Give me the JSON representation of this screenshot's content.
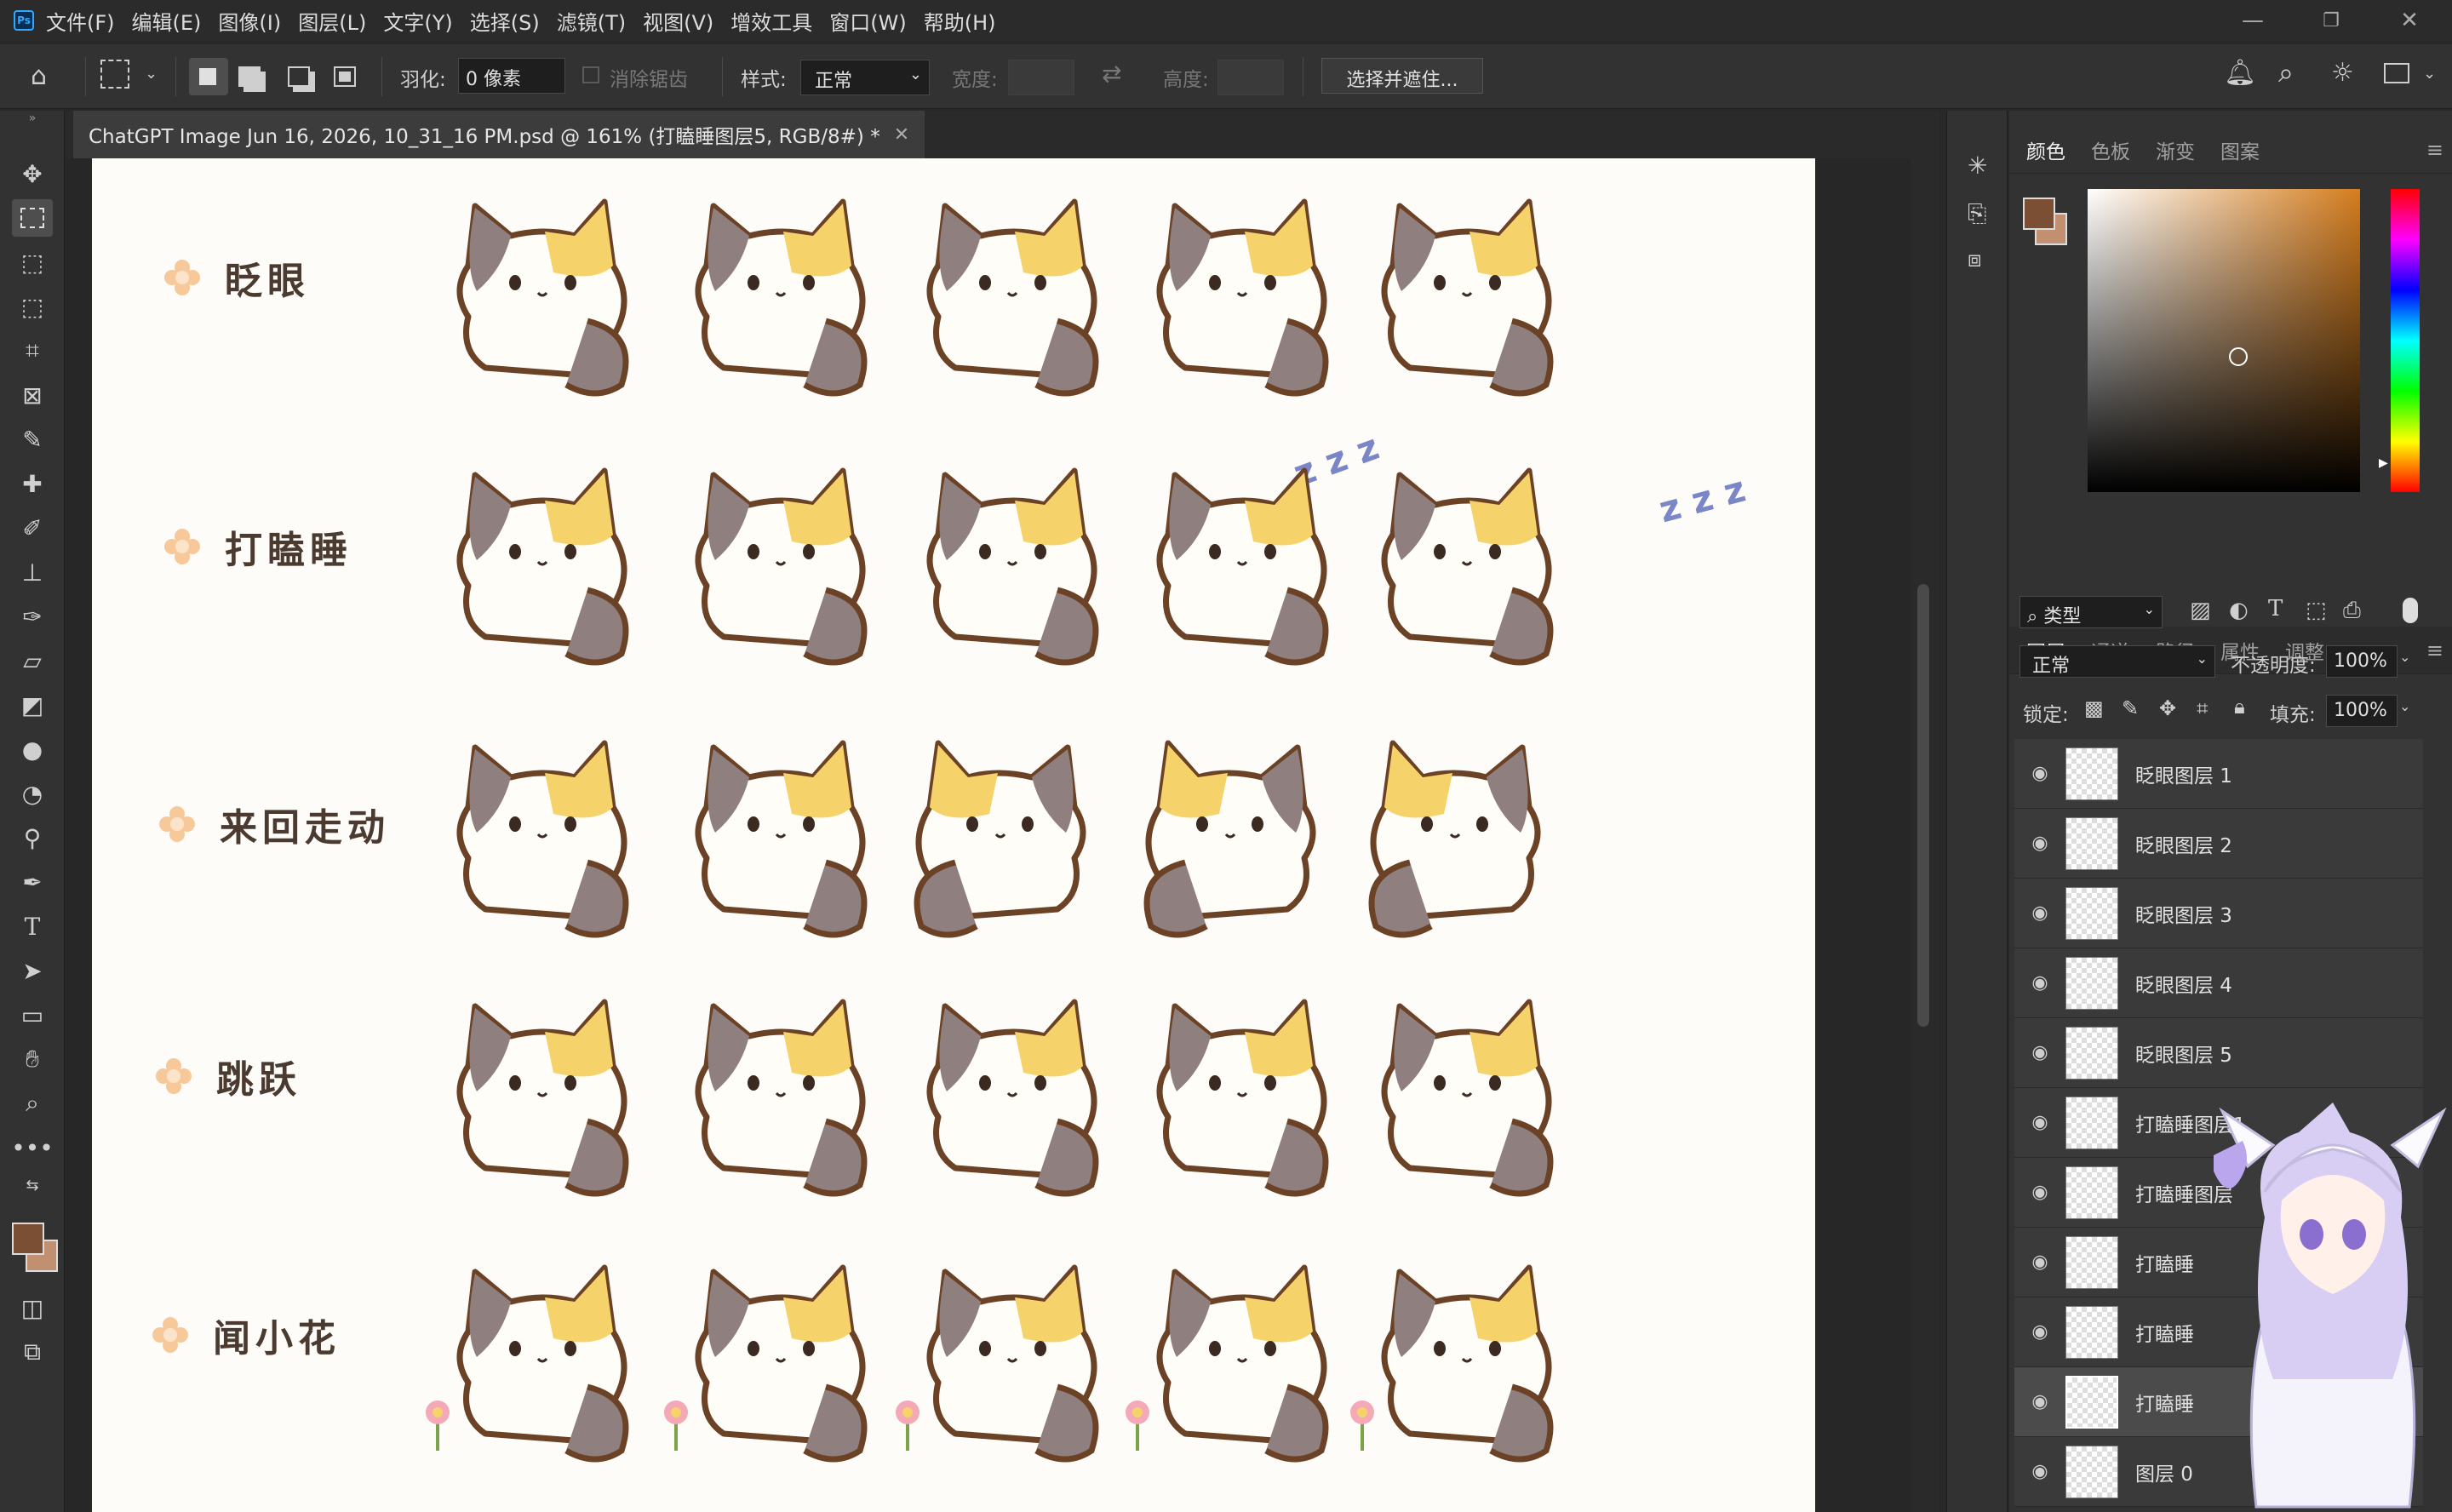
{
  "app": {
    "name": "Photoshop",
    "logo": "Ps"
  },
  "menu": [
    "文件(F)",
    "编辑(E)",
    "图像(I)",
    "图层(L)",
    "文字(Y)",
    "选择(S)",
    "滤镜(T)",
    "视图(V)",
    "增效工具",
    "窗口(W)",
    "帮助(H)"
  ],
  "window_controls": [
    "—",
    "❐",
    "✕"
  ],
  "options": {
    "feather_label": "羽化:",
    "feather_value": "0 像素",
    "antialias_label": "消除锯齿",
    "style_label": "样式:",
    "style_value": "正常",
    "width_label": "宽度:",
    "height_label": "高度:",
    "select_mask_button": "选择并遮住..."
  },
  "document": {
    "tab_title": "ChatGPT Image Jun 16, 2026, 10_31_16 PM.psd @ 161% (打瞌睡图层5, RGB/8#) *",
    "close": "✕"
  },
  "canvas": {
    "rows": [
      {
        "label": "眨眼",
        "frames": 5
      },
      {
        "label": "打瞌睡",
        "frames": 5
      },
      {
        "label": "来回走动",
        "frames": 5
      },
      {
        "label": "跳跃",
        "frames": 5
      },
      {
        "label": "闻小花",
        "frames": 5
      }
    ],
    "zzz": "z z z",
    "colors": {
      "background": "#fdfcf8",
      "outline": "#6b4226",
      "gray_patch": "#8f7f7f",
      "yellow_patch": "#f6d36a",
      "flower": "#f7c99a"
    }
  },
  "color_panel": {
    "tabs": [
      "颜色",
      "色板",
      "渐变",
      "图案"
    ],
    "foreground": "#7a4f33",
    "background": "#c09070"
  },
  "layers_panel": {
    "tabs": [
      "图层",
      "通道",
      "路径",
      "属性",
      "调整"
    ],
    "filter_label": "类型",
    "blend_mode": "正常",
    "opacity_label": "不透明度:",
    "opacity_value": "100%",
    "lock_label": "锁定:",
    "fill_label": "填充:",
    "fill_value": "100%",
    "layers": [
      {
        "name": "眨眼图层 1"
      },
      {
        "name": "眨眼图层 2"
      },
      {
        "name": "眨眼图层 3"
      },
      {
        "name": "眨眼图层 4"
      },
      {
        "name": "眨眼图层 5"
      },
      {
        "name": "打瞌睡图层1"
      },
      {
        "name": "打瞌睡图层"
      },
      {
        "name": "打瞌睡"
      },
      {
        "name": "打瞌睡"
      },
      {
        "name": "打瞌睡",
        "selected": true
      },
      {
        "name": "图层 0"
      }
    ]
  }
}
